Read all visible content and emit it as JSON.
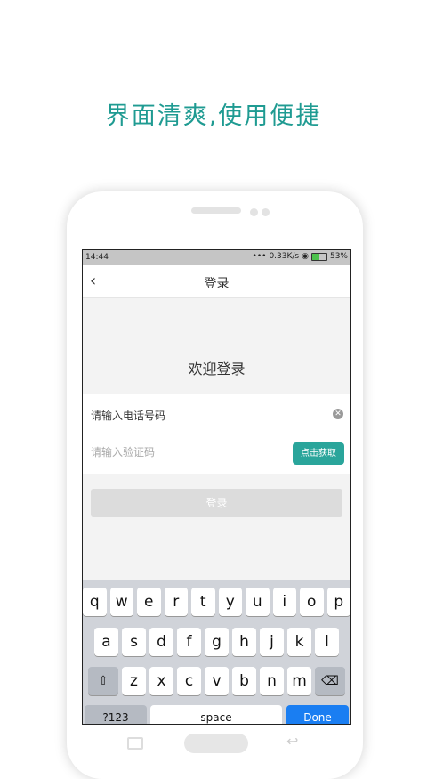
{
  "headline": "界面清爽,使用便捷",
  "status": {
    "time": "14:44",
    "speed": "0.33K/s",
    "battery": "53%",
    "battery_level": 0.53
  },
  "nav": {
    "back_icon": "chevron-left-icon",
    "title": "登录"
  },
  "welcome": "欢迎登录",
  "phone_field": {
    "value": "请输入电话号码"
  },
  "code_field": {
    "placeholder": "请输入验证码"
  },
  "get_code_label": "点击获取",
  "login_label": "登录",
  "keyboard": {
    "row1": [
      "q",
      "w",
      "e",
      "r",
      "t",
      "y",
      "u",
      "i",
      "o",
      "p"
    ],
    "row2": [
      "a",
      "s",
      "d",
      "f",
      "g",
      "h",
      "j",
      "k",
      "l"
    ],
    "row3": [
      "z",
      "x",
      "c",
      "v",
      "b",
      "n",
      "m"
    ],
    "shift": "⇧",
    "delete": "⌫",
    "num_label": "?123",
    "space_label": "space",
    "done_label": "Done"
  },
  "colors": {
    "accent": "#2aa59b",
    "headline": "#1f9b92",
    "done": "#1a7ef2"
  }
}
